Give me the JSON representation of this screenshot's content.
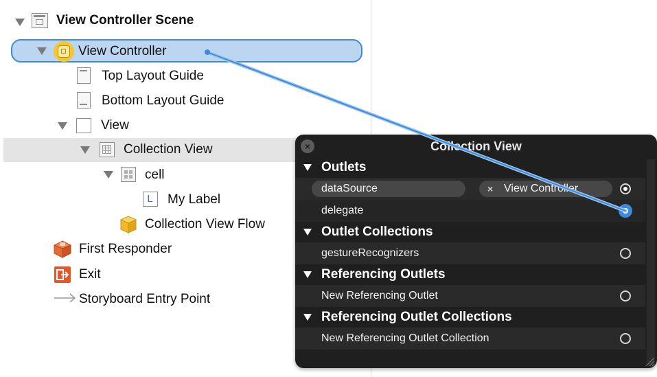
{
  "outline": {
    "scene_title": "View Controller Scene",
    "items": [
      {
        "label": "View Controller"
      },
      {
        "label": "Top Layout Guide"
      },
      {
        "label": "Bottom Layout Guide"
      },
      {
        "label": "View"
      },
      {
        "label": "Collection View"
      },
      {
        "label": "cell"
      },
      {
        "label": "My Label"
      },
      {
        "label": "Collection View Flow"
      },
      {
        "label": "First Responder"
      },
      {
        "label": "Exit"
      },
      {
        "label": "Storyboard Entry Point"
      }
    ],
    "label_icon_letter": "L"
  },
  "popup": {
    "title": "Collection View",
    "close_glyph": "×",
    "sections": {
      "outlets": "Outlets",
      "outlet_collections": "Outlet Collections",
      "referencing_outlets": "Referencing Outlets",
      "referencing_outlet_collections": "Referencing Outlet Collections"
    },
    "rows": {
      "datasource": "dataSource",
      "datasource_connection": "View Controller",
      "datasource_remove_glyph": "×",
      "delegate": "delegate",
      "gesture_recognizers": "gestureRecognizers",
      "new_referencing_outlet": "New Referencing Outlet",
      "new_referencing_outlet_collection": "New Referencing Outlet Collection"
    }
  },
  "colors": {
    "selection_fill": "#bcd6f2",
    "selection_border": "#3d8bd9",
    "popup_bg": "#1f1f1f",
    "drag_line": "#3d8bd9"
  }
}
